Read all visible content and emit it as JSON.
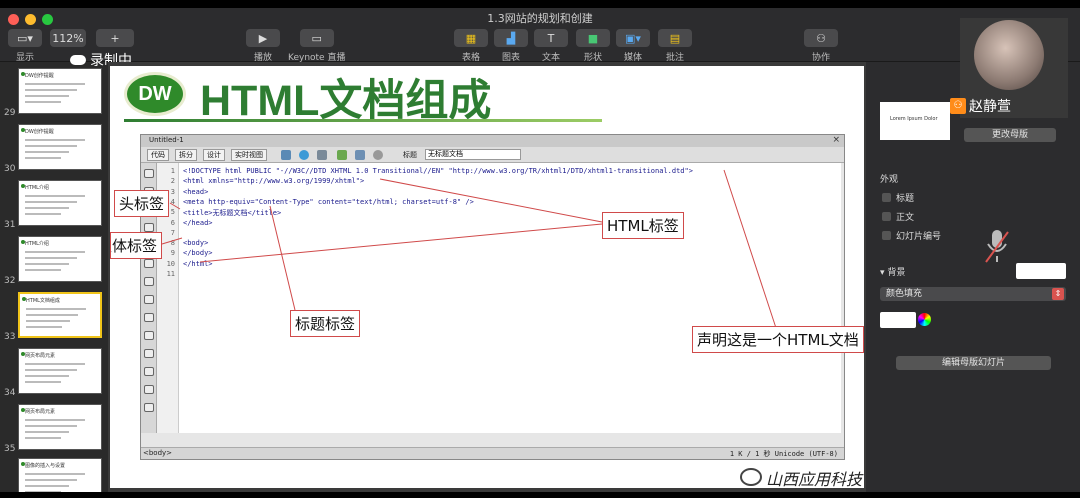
{
  "window": {
    "title": "1.3网站的规划和创建"
  },
  "toolbar": {
    "view_label": "显示",
    "zoom_value": "112%",
    "zoom_label": "缩放",
    "add_slide_label": "添加幻灯片",
    "play_label": "播放",
    "keynote_live_label": "Keynote 直播",
    "table_label": "表格",
    "chart_label": "图表",
    "text_label": "文本",
    "shape_label": "形状",
    "media_label": "媒体",
    "comment_label": "批注",
    "collaborate_label": "协作"
  },
  "recording": {
    "text": "录制中"
  },
  "navigator": {
    "slides": [
      {
        "num": "29",
        "title": "DW创作提醒"
      },
      {
        "num": "30",
        "title": "DW创作提醒"
      },
      {
        "num": "31",
        "title": "HTML介绍"
      },
      {
        "num": "32",
        "title": "HTML介绍"
      },
      {
        "num": "33",
        "title": "HTML文档组成"
      },
      {
        "num": "34",
        "title": "网页布局元素"
      },
      {
        "num": "35",
        "title": "网页布局元素"
      },
      {
        "num": "",
        "title": "图像的插入与设置"
      }
    ]
  },
  "slide": {
    "badge": "DW",
    "title": "HTML文档组成",
    "annotations": {
      "head": "头标签",
      "body": "主体标签",
      "html": "HTML标签",
      "title": "标题标签",
      "doctype": "声明这是一个HTML文档"
    },
    "university": "山西应用科技"
  },
  "dreamweaver": {
    "tab": "Untitled-1",
    "close": "×",
    "view_code": "代码",
    "view_split": "拆分",
    "view_design": "设计",
    "view_live": "实时视图",
    "title_label": "标题",
    "title_value": "无标题文档",
    "line_numbers": [
      "1",
      "2",
      "3",
      "4",
      "5",
      "6",
      "7",
      "8",
      "9",
      "10",
      "11"
    ],
    "code": [
      "<!DOCTYPE html PUBLIC \"-//W3C//DTD XHTML 1.0 Transitional//EN\" \"http://www.w3.org/TR/xhtml1/DTD/xhtml1-transitional.dtd\">",
      "<html xmlns=\"http://www.w3.org/1999/xhtml\">",
      "<head>",
      "<meta http-equiv=\"Content-Type\" content=\"text/html; charset=utf-8\" />",
      "<title>无标题文档</title>",
      "</head>",
      "",
      "<body>",
      "</body>",
      "</html>",
      ""
    ],
    "status_left": "<body>",
    "status_right": "1 K / 1 秒  Unicode (UTF-8)"
  },
  "inspector": {
    "layout_thumb_text": "Lorem Ipsum Dolor",
    "change_master": "更改母版",
    "appearance": "外观",
    "checkboxes": [
      "标题",
      "正文",
      "幻灯片编号"
    ],
    "background": "背景",
    "fill": "颜色填充",
    "edit_master": "编辑母版幻灯片"
  },
  "video": {
    "host_name": "赵静萱"
  }
}
